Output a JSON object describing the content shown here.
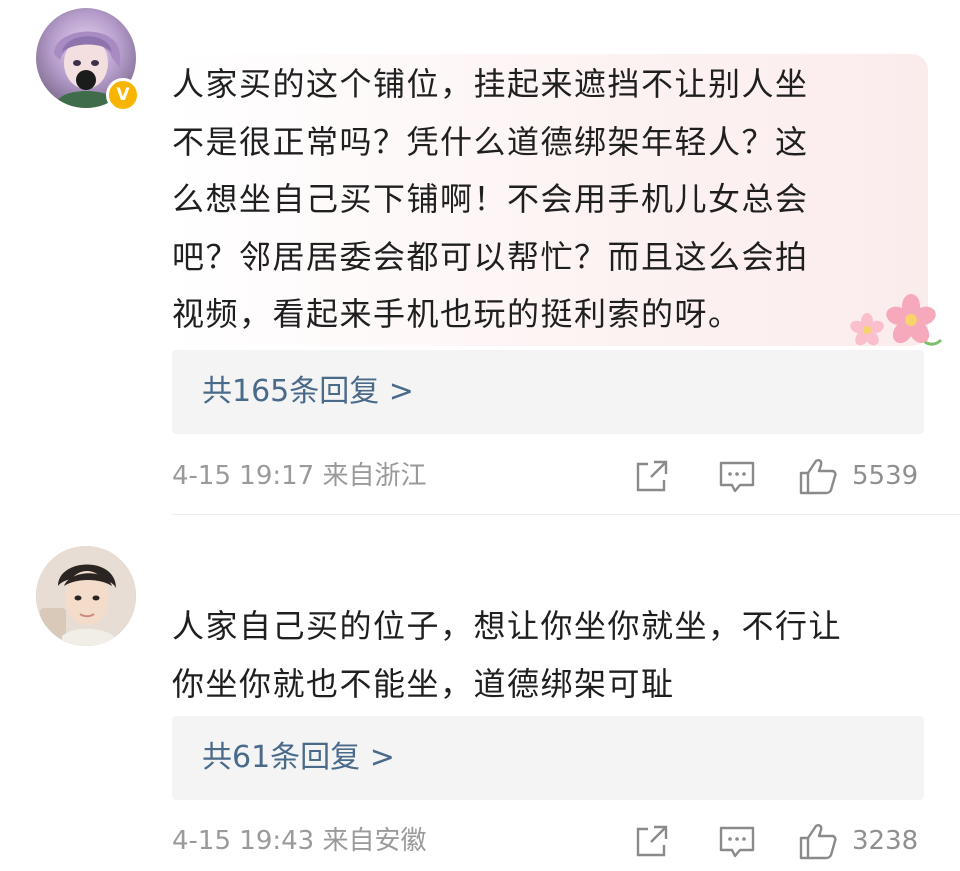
{
  "comments": [
    {
      "avatar_icon": "anime-avatar-icon",
      "verified_badge": "V",
      "text": "人家买的这个铺位，挂起来遮挡不让别人坐\n不是很正常吗？凭什么道德绑架年轻人？这\n么想坐自己买下铺啊！不会用手机儿女总会\n吧？邻居居委会都可以帮忙？而且这么会拍\n视频，看起来手机也玩的挺利索的呀。",
      "replies_label": "共165条回复 >",
      "timestamp": "4-15 19:17",
      "location": "来自浙江",
      "likes": "5539",
      "decoration": "cherry-blossom-icon"
    },
    {
      "avatar_icon": "person-photo-avatar-icon",
      "text": "人家自己买的位子，想让你坐你就坐，不行让\n你坐你就也不能坐，道德绑架可耻",
      "replies_label": "共61条回复 >",
      "timestamp": "4-15 19:43",
      "location": "来自安徽",
      "likes": "3238"
    }
  ],
  "colors": {
    "link": "#4a6a8a",
    "meta": "#9a9a9a",
    "badge": "#f7b500",
    "reply_bg": "#f4f4f4",
    "bubble_tint": "#fbecec"
  }
}
